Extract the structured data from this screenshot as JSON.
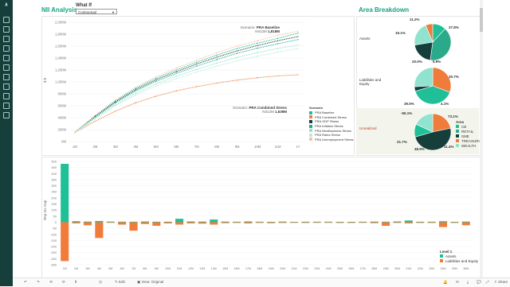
{
  "nii": {
    "title": "NII Analysis",
    "whatif_label": "What If",
    "select_value": "Contractual",
    "y_axis_label": "$ b",
    "callout_top": {
      "prefix": "Scenario:",
      "name": "PRA Baseline",
      "metric": "NII12M",
      "value": "1,818M"
    },
    "callout_bottom": {
      "prefix": "Scenario:",
      "name": "PRA Combined Stress",
      "metric": "NII12M",
      "value": "1,639M"
    },
    "legend_title": "Scenario"
  },
  "area": {
    "title": "Area Breakdown",
    "rows": [
      {
        "label": "Assets",
        "pcts": [
          "11.2%",
          "37.8%",
          "19.1%",
          "20.0%",
          "5.9%"
        ]
      },
      {
        "label": "Liabilities and Equity",
        "pcts": [
          "30.7%",
          "39.5%",
          "4.1%"
        ]
      },
      {
        "label": "Unrealized",
        "pcts": [
          "-55.1%",
          "73.1%",
          "21.7%",
          "48.9%",
          "11.4%"
        ]
      }
    ],
    "legend_title": "Area",
    "legend": [
      {
        "name": "CB",
        "color": "#1fbf97"
      },
      {
        "name": "RETAIL",
        "color": "#2aaa8a"
      },
      {
        "name": "SME",
        "color": "#163f3b"
      },
      {
        "name": "TREASURY",
        "color": "#ef7c3a"
      },
      {
        "name": "WEALTH",
        "color": "#8fe3cf"
      }
    ]
  },
  "bottom_panel": {
    "y_axis_label": "Rep rec Gap",
    "legend_title": "Level 1",
    "legend": [
      {
        "name": "Assets",
        "color": "#1fbf97"
      },
      {
        "name": "Liabilities and Equity",
        "color": "#ef7c3a"
      }
    ]
  },
  "toolbar": {
    "edit": "Edit",
    "view_original": "View: Original",
    "share": "Share"
  },
  "chart_data": [
    {
      "type": "line",
      "x": [
        "1M",
        "2M",
        "3M",
        "4M",
        "5M",
        "6M",
        "7M",
        "8M",
        "9M",
        "10M",
        "11M",
        "1Y"
      ],
      "ylim": [
        0,
        2000
      ],
      "yticks": [
        "0M",
        "200M",
        "400M",
        "600M",
        "800M",
        "1,000M",
        "1,200M",
        "1,400M",
        "1,600M",
        "1,800M",
        "2,000M"
      ],
      "series": [
        {
          "name": "PRA Baseline",
          "color": "#1fbf97",
          "values": [
            160,
            430,
            680,
            890,
            1060,
            1200,
            1330,
            1450,
            1560,
            1650,
            1730,
            1818
          ]
        },
        {
          "name": "PRA Combined Stress",
          "color": "#ef7c3a",
          "values": [
            150,
            340,
            510,
            650,
            760,
            850,
            920,
            980,
            1030,
            1070,
            1100,
            1120
          ]
        },
        {
          "name": "PRA GDP Stress",
          "color": "#163f3b",
          "values": [
            158,
            420,
            665,
            870,
            1035,
            1170,
            1300,
            1415,
            1520,
            1610,
            1690,
            1760
          ]
        },
        {
          "name": "PRA Inflation Stress",
          "color": "#2aaa8a",
          "values": [
            155,
            410,
            650,
            850,
            1010,
            1140,
            1265,
            1375,
            1480,
            1565,
            1640,
            1710
          ]
        },
        {
          "name": "PRA NewBusiness Stress",
          "color": "#8fe3cf",
          "values": [
            150,
            395,
            620,
            810,
            965,
            1095,
            1210,
            1315,
            1410,
            1490,
            1560,
            1620
          ]
        },
        {
          "name": "PRA Rates Stress",
          "color": "#b7eadc",
          "values": [
            145,
            380,
            600,
            780,
            930,
            1055,
            1165,
            1265,
            1355,
            1430,
            1500,
            1560
          ]
        },
        {
          "name": "PRA Unemployment Stress",
          "color": "#f6c1a2",
          "values": [
            160,
            440,
            700,
            910,
            1085,
            1230,
            1365,
            1490,
            1600,
            1690,
            1780,
            1850
          ]
        }
      ]
    },
    {
      "type": "bar",
      "ylim": [
        -350,
        500
      ],
      "yticks": [
        "-350",
        "-300",
        "-250",
        "-200",
        "-150",
        "-100",
        "-50",
        "0",
        "50",
        "100",
        "150",
        "200",
        "250",
        "300",
        "350",
        "400",
        "450",
        "500"
      ],
      "categories": [
        "1M",
        "2M",
        "3M",
        "4M",
        "5M",
        "6M",
        "7M",
        "8M",
        "9M",
        "10M",
        "11M",
        "12M",
        "13M",
        "14M",
        "15M",
        "16M",
        "17M",
        "18M",
        "19M",
        "20M",
        "21M",
        "22M",
        "23M",
        "24M",
        "25M",
        "26M",
        "27M",
        "28M",
        "29M",
        "30M",
        "31M",
        "32M",
        "33M",
        "34M",
        "35M",
        "36M"
      ],
      "series": [
        {
          "name": "Assets",
          "color": "#1fbf97",
          "values": [
            480,
            8,
            5,
            10,
            5,
            4,
            4,
            6,
            4,
            4,
            28,
            6,
            5,
            22,
            5,
            4,
            6,
            4,
            3,
            5,
            3,
            4,
            4,
            4,
            3,
            3,
            4,
            5,
            4,
            6,
            14,
            4,
            4,
            8,
            3,
            5
          ]
        },
        {
          "name": "Liabilities and Equity",
          "color": "#ef7c3a",
          "values": [
            -320,
            -10,
            -25,
            -130,
            -5,
            -20,
            -70,
            -15,
            -30,
            -10,
            -20,
            -10,
            -12,
            -20,
            -8,
            -6,
            -10,
            -6,
            -8,
            -6,
            -5,
            -6,
            -5,
            -5,
            -6,
            -6,
            -5,
            -8,
            -30,
            -6,
            -10,
            -6,
            -6,
            -40,
            -6,
            -25
          ]
        }
      ]
    },
    {
      "type": "pie",
      "title": "Assets",
      "slices": [
        {
          "name": "CB",
          "value": 11.2,
          "color": "#1fbf97"
        },
        {
          "name": "RETAIL",
          "value": 37.8,
          "color": "#2aaa8a"
        },
        {
          "name": "SME",
          "value": 19.1,
          "color": "#163f3b"
        },
        {
          "name": "TREASURY",
          "value": 20.0,
          "color": "#8fe3cf"
        },
        {
          "name": "WEALTH",
          "value": 5.9,
          "color": "#ef7c3a"
        }
      ]
    },
    {
      "type": "pie",
      "title": "Liabilities and Equity",
      "slices": [
        {
          "name": "CB",
          "value": 30.7,
          "color": "#ef7c3a"
        },
        {
          "name": "RETAIL",
          "value": 39.5,
          "color": "#1fbf97"
        },
        {
          "name": "SME",
          "value": 4.1,
          "color": "#163f3b"
        },
        {
          "name": "WEALTH",
          "value": 25.7,
          "color": "#8fe3cf"
        }
      ]
    },
    {
      "type": "pie",
      "title": "Unrealized",
      "slices": [
        {
          "name": "CB",
          "value": 21.7,
          "color": "#ef7c3a"
        },
        {
          "name": "RETAIL",
          "value": 48.9,
          "color": "#163f3b"
        },
        {
          "name": "SME",
          "value": 11.4,
          "color": "#1fbf97"
        },
        {
          "name": "WEALTH",
          "value": 18.0,
          "color": "#8fe3cf"
        }
      ]
    }
  ]
}
